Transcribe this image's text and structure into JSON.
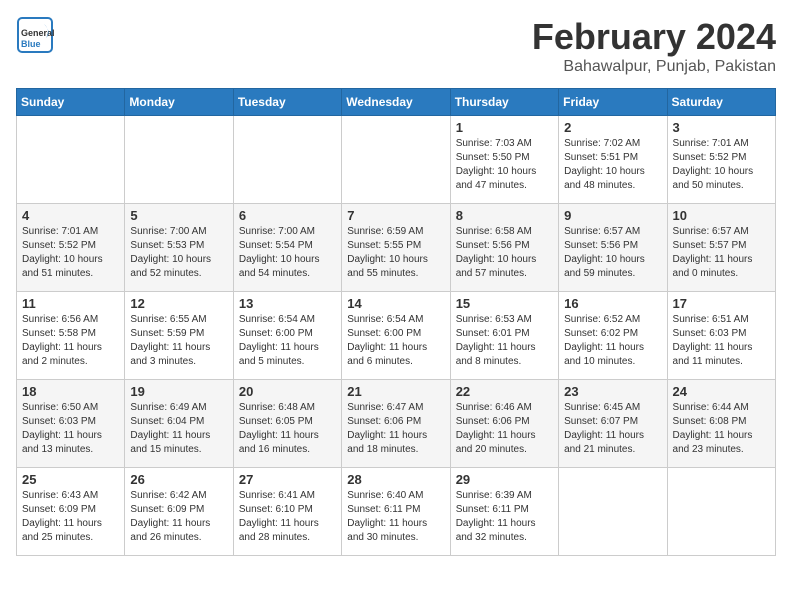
{
  "header": {
    "logo_general": "General",
    "logo_blue": "Blue",
    "title": "February 2024",
    "subtitle": "Bahawalpur, Punjab, Pakistan"
  },
  "days_of_week": [
    "Sunday",
    "Monday",
    "Tuesday",
    "Wednesday",
    "Thursday",
    "Friday",
    "Saturday"
  ],
  "weeks": [
    [
      {
        "day": "",
        "sunrise": "",
        "sunset": "",
        "daylight": ""
      },
      {
        "day": "",
        "sunrise": "",
        "sunset": "",
        "daylight": ""
      },
      {
        "day": "",
        "sunrise": "",
        "sunset": "",
        "daylight": ""
      },
      {
        "day": "",
        "sunrise": "",
        "sunset": "",
        "daylight": ""
      },
      {
        "day": "1",
        "sunrise": "Sunrise: 7:03 AM",
        "sunset": "Sunset: 5:50 PM",
        "daylight": "Daylight: 10 hours and 47 minutes."
      },
      {
        "day": "2",
        "sunrise": "Sunrise: 7:02 AM",
        "sunset": "Sunset: 5:51 PM",
        "daylight": "Daylight: 10 hours and 48 minutes."
      },
      {
        "day": "3",
        "sunrise": "Sunrise: 7:01 AM",
        "sunset": "Sunset: 5:52 PM",
        "daylight": "Daylight: 10 hours and 50 minutes."
      }
    ],
    [
      {
        "day": "4",
        "sunrise": "Sunrise: 7:01 AM",
        "sunset": "Sunset: 5:52 PM",
        "daylight": "Daylight: 10 hours and 51 minutes."
      },
      {
        "day": "5",
        "sunrise": "Sunrise: 7:00 AM",
        "sunset": "Sunset: 5:53 PM",
        "daylight": "Daylight: 10 hours and 52 minutes."
      },
      {
        "day": "6",
        "sunrise": "Sunrise: 7:00 AM",
        "sunset": "Sunset: 5:54 PM",
        "daylight": "Daylight: 10 hours and 54 minutes."
      },
      {
        "day": "7",
        "sunrise": "Sunrise: 6:59 AM",
        "sunset": "Sunset: 5:55 PM",
        "daylight": "Daylight: 10 hours and 55 minutes."
      },
      {
        "day": "8",
        "sunrise": "Sunrise: 6:58 AM",
        "sunset": "Sunset: 5:56 PM",
        "daylight": "Daylight: 10 hours and 57 minutes."
      },
      {
        "day": "9",
        "sunrise": "Sunrise: 6:57 AM",
        "sunset": "Sunset: 5:56 PM",
        "daylight": "Daylight: 10 hours and 59 minutes."
      },
      {
        "day": "10",
        "sunrise": "Sunrise: 6:57 AM",
        "sunset": "Sunset: 5:57 PM",
        "daylight": "Daylight: 11 hours and 0 minutes."
      }
    ],
    [
      {
        "day": "11",
        "sunrise": "Sunrise: 6:56 AM",
        "sunset": "Sunset: 5:58 PM",
        "daylight": "Daylight: 11 hours and 2 minutes."
      },
      {
        "day": "12",
        "sunrise": "Sunrise: 6:55 AM",
        "sunset": "Sunset: 5:59 PM",
        "daylight": "Daylight: 11 hours and 3 minutes."
      },
      {
        "day": "13",
        "sunrise": "Sunrise: 6:54 AM",
        "sunset": "Sunset: 6:00 PM",
        "daylight": "Daylight: 11 hours and 5 minutes."
      },
      {
        "day": "14",
        "sunrise": "Sunrise: 6:54 AM",
        "sunset": "Sunset: 6:00 PM",
        "daylight": "Daylight: 11 hours and 6 minutes."
      },
      {
        "day": "15",
        "sunrise": "Sunrise: 6:53 AM",
        "sunset": "Sunset: 6:01 PM",
        "daylight": "Daylight: 11 hours and 8 minutes."
      },
      {
        "day": "16",
        "sunrise": "Sunrise: 6:52 AM",
        "sunset": "Sunset: 6:02 PM",
        "daylight": "Daylight: 11 hours and 10 minutes."
      },
      {
        "day": "17",
        "sunrise": "Sunrise: 6:51 AM",
        "sunset": "Sunset: 6:03 PM",
        "daylight": "Daylight: 11 hours and 11 minutes."
      }
    ],
    [
      {
        "day": "18",
        "sunrise": "Sunrise: 6:50 AM",
        "sunset": "Sunset: 6:03 PM",
        "daylight": "Daylight: 11 hours and 13 minutes."
      },
      {
        "day": "19",
        "sunrise": "Sunrise: 6:49 AM",
        "sunset": "Sunset: 6:04 PM",
        "daylight": "Daylight: 11 hours and 15 minutes."
      },
      {
        "day": "20",
        "sunrise": "Sunrise: 6:48 AM",
        "sunset": "Sunset: 6:05 PM",
        "daylight": "Daylight: 11 hours and 16 minutes."
      },
      {
        "day": "21",
        "sunrise": "Sunrise: 6:47 AM",
        "sunset": "Sunset: 6:06 PM",
        "daylight": "Daylight: 11 hours and 18 minutes."
      },
      {
        "day": "22",
        "sunrise": "Sunrise: 6:46 AM",
        "sunset": "Sunset: 6:06 PM",
        "daylight": "Daylight: 11 hours and 20 minutes."
      },
      {
        "day": "23",
        "sunrise": "Sunrise: 6:45 AM",
        "sunset": "Sunset: 6:07 PM",
        "daylight": "Daylight: 11 hours and 21 minutes."
      },
      {
        "day": "24",
        "sunrise": "Sunrise: 6:44 AM",
        "sunset": "Sunset: 6:08 PM",
        "daylight": "Daylight: 11 hours and 23 minutes."
      }
    ],
    [
      {
        "day": "25",
        "sunrise": "Sunrise: 6:43 AM",
        "sunset": "Sunset: 6:09 PM",
        "daylight": "Daylight: 11 hours and 25 minutes."
      },
      {
        "day": "26",
        "sunrise": "Sunrise: 6:42 AM",
        "sunset": "Sunset: 6:09 PM",
        "daylight": "Daylight: 11 hours and 26 minutes."
      },
      {
        "day": "27",
        "sunrise": "Sunrise: 6:41 AM",
        "sunset": "Sunset: 6:10 PM",
        "daylight": "Daylight: 11 hours and 28 minutes."
      },
      {
        "day": "28",
        "sunrise": "Sunrise: 6:40 AM",
        "sunset": "Sunset: 6:11 PM",
        "daylight": "Daylight: 11 hours and 30 minutes."
      },
      {
        "day": "29",
        "sunrise": "Sunrise: 6:39 AM",
        "sunset": "Sunset: 6:11 PM",
        "daylight": "Daylight: 11 hours and 32 minutes."
      },
      {
        "day": "",
        "sunrise": "",
        "sunset": "",
        "daylight": ""
      },
      {
        "day": "",
        "sunrise": "",
        "sunset": "",
        "daylight": ""
      }
    ]
  ]
}
